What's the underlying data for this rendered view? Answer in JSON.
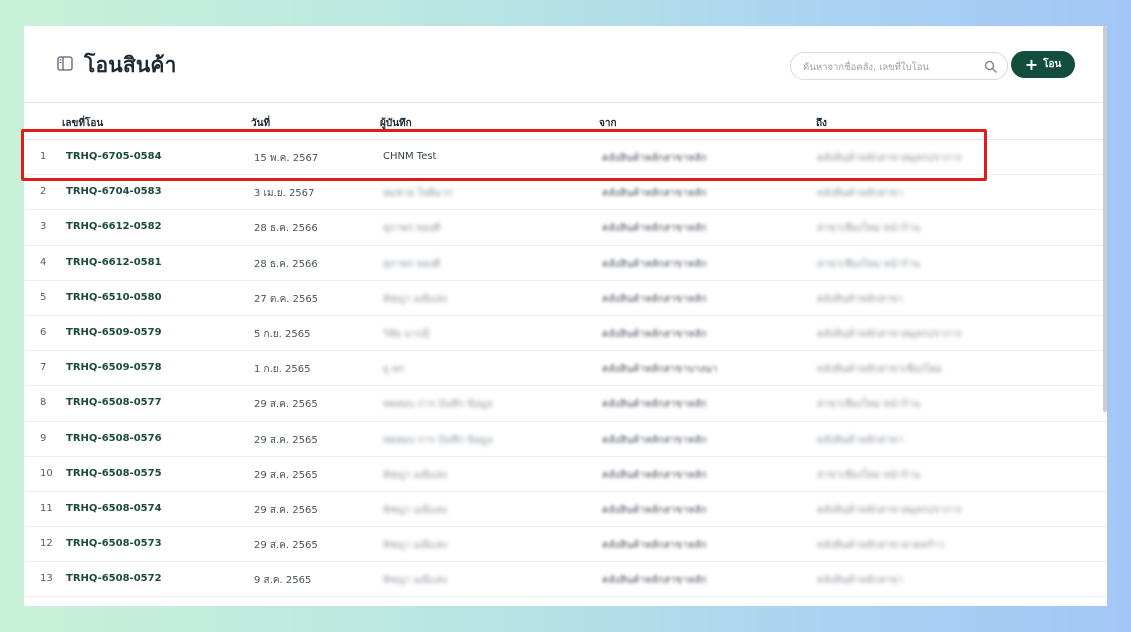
{
  "header": {
    "title": "โอนสินค้า",
    "title_icon": "sidebar-panel-icon",
    "search_placeholder": "ค้นหาจากชื่อคลัง, เลขที่ใบโอน",
    "search_icon": "search-icon",
    "add_button_label": "โอน",
    "add_button_icon": "plus-icon",
    "accent_color": "#134e3d",
    "highlight_color": "#e01b1b"
  },
  "table": {
    "columns": [
      "เลขที่โอน",
      "วันที่",
      "ผู้บันทึก",
      "จาก",
      "ถึง"
    ],
    "rows": [
      {
        "num": "1",
        "id": "TRHQ-6705-0584",
        "date": "15 พ.ค. 2567",
        "recorder": "CHNM Test",
        "from": "คลังสินค้าหลักสาขาหลัก",
        "to": "คลังสินค้าหลักสาขาสมุทรปราการ"
      },
      {
        "num": "2",
        "id": "TRHQ-6704-0583",
        "date": "3 เม.ย. 2567",
        "recorder": "สมชาย ใจดีมาก",
        "from": "คลังสินค้าหลักสาขาหลัก",
        "to": "คลังสินค้าหลักสาขา"
      },
      {
        "num": "3",
        "id": "TRHQ-6612-0582",
        "date": "28 ธ.ค. 2566",
        "recorder": "สุภาพร ทองดี",
        "from": "คลังสินค้าหลักสาขาหลัก",
        "to": "สาขาเชียงใหม่ หน้าร้าน"
      },
      {
        "num": "4",
        "id": "TRHQ-6612-0581",
        "date": "28 ธ.ค. 2566",
        "recorder": "สุภาพร ทองดี",
        "from": "คลังสินค้าหลักสาขาหลัก",
        "to": "สาขาเชียงใหม่ หน้าร้าน"
      },
      {
        "num": "5",
        "id": "TRHQ-6510-0580",
        "date": "27 ต.ค. 2565",
        "recorder": "พิชญา มณีแสง",
        "from": "คลังสินค้าหลักสาขาหลัก",
        "to": "คลังสินค้าหลักสาขา"
      },
      {
        "num": "6",
        "id": "TRHQ-6509-0579",
        "date": "5 ก.ย. 2565",
        "recorder": "วิชัย มากมี",
        "from": "คลังสินค้าหลักสาขาหลัก",
        "to": "คลังสินค้าหลักสาขาสมุทรปราการ"
      },
      {
        "num": "7",
        "id": "TRHQ-6509-0578",
        "date": "1 ก.ย. 2565",
        "recorder": "ยุ พร",
        "from": "คลังสินค้าหลักสาขาบางนา",
        "to": "คลังสินค้าหลักสาขาเชียงใหม่"
      },
      {
        "num": "8",
        "id": "TRHQ-6508-0577",
        "date": "29 ส.ค. 2565",
        "recorder": "ทดสอบ การ บันทึก ข้อมูล",
        "from": "คลังสินค้าหลักสาขาหลัก",
        "to": "สาขาเชียงใหม่ หน้าร้าน"
      },
      {
        "num": "9",
        "id": "TRHQ-6508-0576",
        "date": "29 ส.ค. 2565",
        "recorder": "ทดสอบ การ บันทึก ข้อมูล",
        "from": "คลังสินค้าหลักสาขาหลัก",
        "to": "คลังสินค้าหลักสาขา"
      },
      {
        "num": "10",
        "id": "TRHQ-6508-0575",
        "date": "29 ส.ค. 2565",
        "recorder": "พิชญา มณีแสง",
        "from": "คลังสินค้าหลักสาขาหลัก",
        "to": "สาขาเชียงใหม่ หน้าร้าน"
      },
      {
        "num": "11",
        "id": "TRHQ-6508-0574",
        "date": "29 ส.ค. 2565",
        "recorder": "พิชญา มณีแสง",
        "from": "คลังสินค้าหลักสาขาหลัก",
        "to": "คลังสินค้าหลักสาขาสมุทรปราการ"
      },
      {
        "num": "12",
        "id": "TRHQ-6508-0573",
        "date": "29 ส.ค. 2565",
        "recorder": "พิชญา มณีแสง",
        "from": "คลังสินค้าหลักสาขาหลัก",
        "to": "คลังสินค้าหลักสาขาลาดพร้าว"
      },
      {
        "num": "13",
        "id": "TRHQ-6508-0572",
        "date": "9 ส.ค. 2565",
        "recorder": "พิชญา มณีแสง",
        "from": "คลังสินค้าหลักสาขาหลัก",
        "to": "คลังสินค้าหลักสาขา"
      }
    ]
  }
}
